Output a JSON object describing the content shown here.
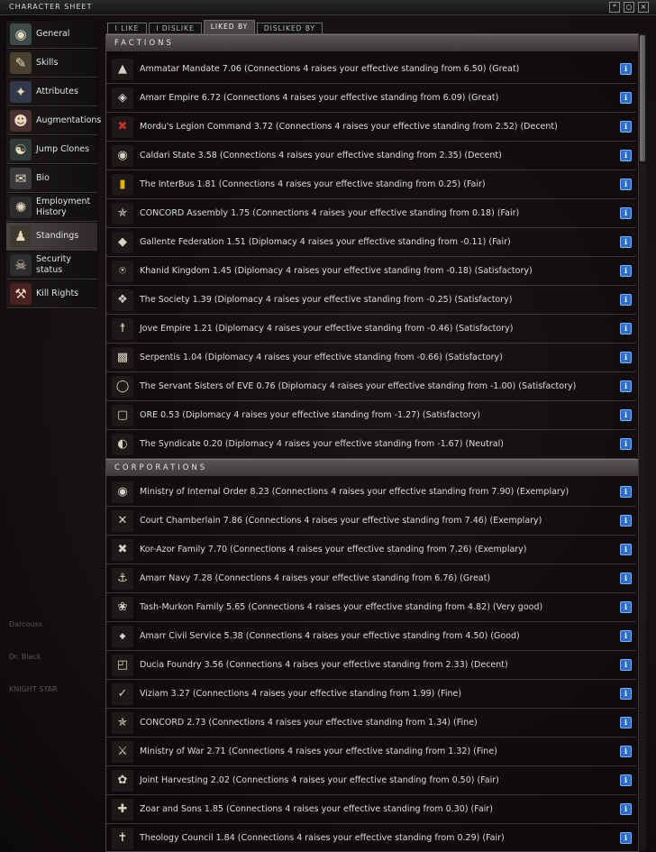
{
  "window": {
    "title": "CHARACTER SHEET",
    "controls": [
      "*",
      "○",
      "×"
    ]
  },
  "sidebar": {
    "items": [
      {
        "label": "General",
        "icon": "general-icon",
        "active": false
      },
      {
        "label": "Skills",
        "icon": "skills-icon",
        "active": false
      },
      {
        "label": "Attributes",
        "icon": "attributes-icon",
        "active": false
      },
      {
        "label": "Augmentations",
        "icon": "augmentations-icon",
        "active": false
      },
      {
        "label": "Jump Clones",
        "icon": "jump-clones-icon",
        "active": false
      },
      {
        "label": "Bio",
        "icon": "bio-icon",
        "active": false
      },
      {
        "label": "Employment History",
        "icon": "employment-history-icon",
        "active": false
      },
      {
        "label": "Standings",
        "icon": "standings-icon",
        "active": true
      },
      {
        "label": "Security status",
        "icon": "security-status-icon",
        "active": false
      },
      {
        "label": "Kill Rights",
        "icon": "kill-rights-icon",
        "active": false
      }
    ]
  },
  "tabs": [
    {
      "label": "I LIKE",
      "active": false
    },
    {
      "label": "I DISLIKE",
      "active": false
    },
    {
      "label": "LIKED BY",
      "active": true
    },
    {
      "label": "DISLIKED BY",
      "active": false
    }
  ],
  "sections": {
    "factions": {
      "header": "FACTIONS",
      "rows": [
        "Ammatar Mandate 7.06 (Connections 4 raises your effective standing from 6.50) (Great)",
        "Amarr Empire 6.72 (Connections 4 raises your effective standing from 6.09) (Great)",
        "Mordu's Legion Command 3.72 (Connections 4 raises your effective standing from 2.52) (Decent)",
        "Caldari State 3.58 (Connections 4 raises your effective standing from 2.35) (Decent)",
        "The InterBus 1.81 (Connections 4 raises your effective standing from 0.25) (Fair)",
        "CONCORD Assembly 1.75 (Connections 4 raises your effective standing from 0.18) (Fair)",
        "Gallente Federation 1.51 (Diplomacy 4 raises your effective standing from -0.11) (Fair)",
        "Khanid Kingdom 1.45 (Diplomacy 4 raises your effective standing from -0.18) (Satisfactory)",
        "The Society 1.39 (Diplomacy 4 raises your effective standing from -0.25) (Satisfactory)",
        "Jove Empire 1.21 (Diplomacy 4 raises your effective standing from -0.46) (Satisfactory)",
        "Serpentis 1.04 (Diplomacy 4 raises your effective standing from -0.66) (Satisfactory)",
        "The Servant Sisters of EVE 0.76 (Diplomacy 4 raises your effective standing from -1.00) (Satisfactory)",
        "ORE 0.53 (Diplomacy 4 raises your effective standing from -1.27) (Satisfactory)",
        "The Syndicate 0.20 (Diplomacy 4 raises your effective standing from -1.67) (Neutral)"
      ]
    },
    "corporations": {
      "header": "CORPORATIONS",
      "rows": [
        "Ministry of Internal Order 8.23 (Connections 4 raises your effective standing from 7.90) (Exemplary)",
        "Court Chamberlain 7.86 (Connections 4 raises your effective standing from 7.46) (Exemplary)",
        "Kor-Azor Family 7.70 (Connections 4 raises your effective standing from 7.26) (Exemplary)",
        "Amarr Navy 7.28 (Connections 4 raises your effective standing from 6.76) (Great)",
        "Tash-Murkon Family 5.65 (Connections 4 raises your effective standing from 4.82) (Very good)",
        "Amarr Civil Service 5.38 (Connections 4 raises your effective standing from 4.50) (Good)",
        "Ducia Foundry 3.56 (Connections 4 raises your effective standing from 2.33) (Decent)",
        "Viziam 3.27 (Connections 4 raises your effective standing from 1.99) (Fine)",
        "CONCORD 2.73 (Connections 4 raises your effective standing from 1.34) (Fine)",
        "Ministry of War 2.71 (Connections 4 raises your effective standing from 1.32) (Fine)",
        "Joint Harvesting 2.02 (Connections 4 raises your effective standing from 0.50) (Fair)",
        "Zoar and Sons 1.85 (Connections 4 raises your effective standing from 0.30) (Fair)",
        "Theology Council 1.84 (Connections 4 raises your effective standing from 0.29) (Fair)"
      ]
    }
  },
  "info_button_label": "i",
  "background_ghost_text": [
    "Darcouss",
    "Dr. Black",
    "KNIGHT STAR"
  ]
}
